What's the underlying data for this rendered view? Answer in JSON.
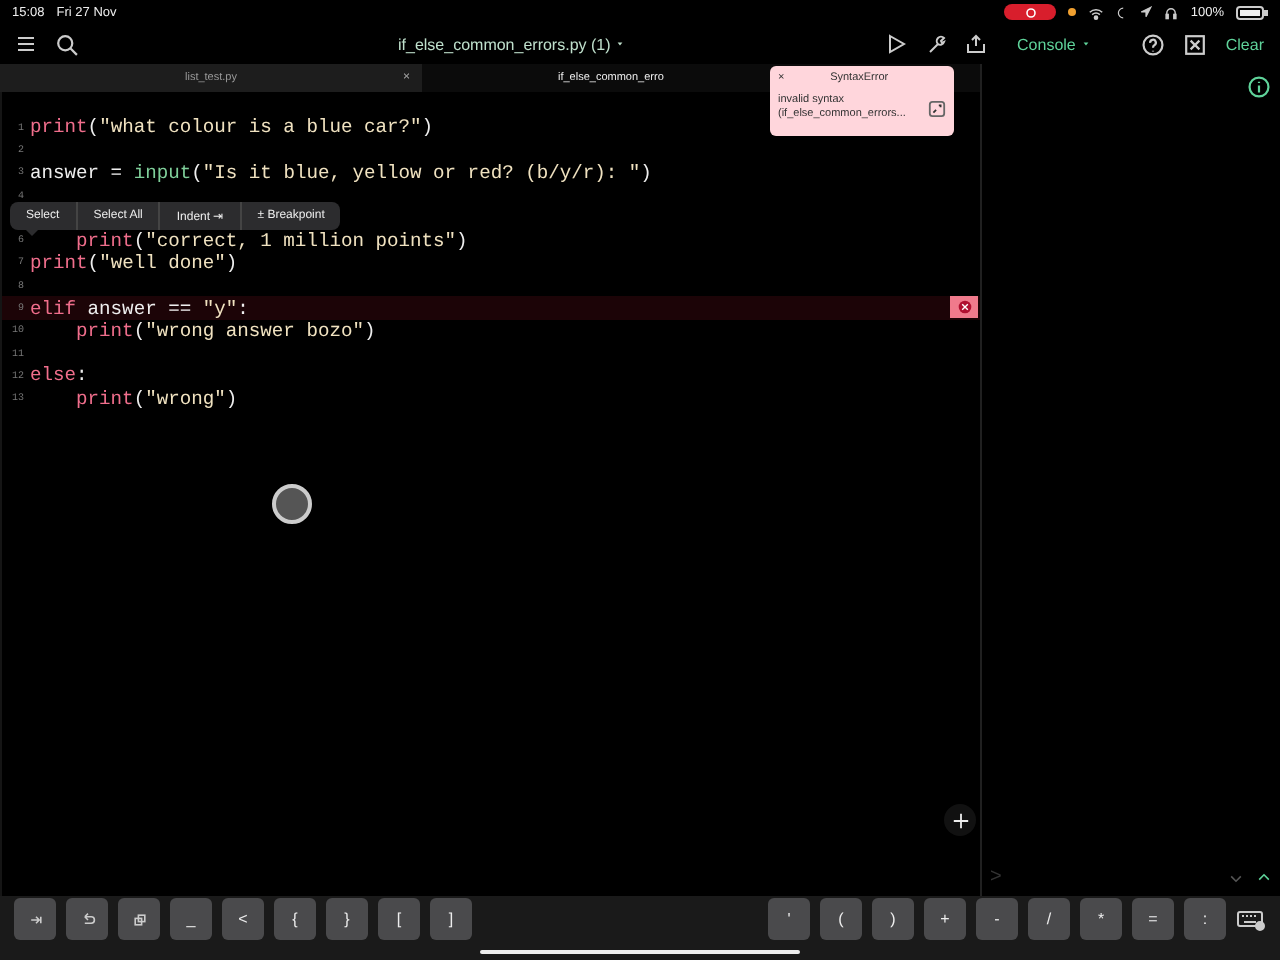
{
  "status_bar": {
    "time": "15:08",
    "date": "Fri 27 Nov",
    "battery": "100%"
  },
  "toolbar": {
    "title": "if_else_common_errors.py (1)",
    "console": "Console",
    "clear": "Clear"
  },
  "tabs": [
    {
      "label": "list_test.py",
      "selected": false,
      "close": "×"
    },
    {
      "label": "if_else_common_erro",
      "selected": true
    }
  ],
  "code_lines": [
    {
      "number": "1",
      "error": false,
      "tokens": [
        {
          "kind": "keyword",
          "t": "print"
        },
        {
          "kind": "plain",
          "t": "("
        },
        {
          "kind": "string",
          "t": "\"what colour is a blue car?\""
        },
        {
          "kind": "plain",
          "t": ")"
        }
      ]
    },
    {
      "number": "2",
      "error": false
    },
    {
      "number": "3",
      "error": false,
      "tokens": [
        {
          "kind": "plain",
          "t": "answer = "
        },
        {
          "kind": "builtin",
          "t": "input"
        },
        {
          "kind": "plain",
          "t": "("
        },
        {
          "kind": "string",
          "t": "\"Is it blue, yellow or red? (b/y/r): \""
        },
        {
          "kind": "plain",
          "t": ")"
        }
      ]
    },
    {
      "number": "4",
      "error": false
    },
    {
      "number": "6",
      "error": false,
      "tokens": [
        {
          "kind": "keyword",
          "t": "    print"
        },
        {
          "kind": "plain",
          "t": "("
        },
        {
          "kind": "string",
          "t": "\"correct, 1 million points\""
        },
        {
          "kind": "plain",
          "t": ")"
        }
      ]
    },
    {
      "number": "7",
      "error": false,
      "tokens": [
        {
          "kind": "keyword",
          "t": "print"
        },
        {
          "kind": "plain",
          "t": "("
        },
        {
          "kind": "string",
          "t": "\"well done\""
        },
        {
          "kind": "plain",
          "t": ")"
        }
      ]
    },
    {
      "number": "8",
      "error": false
    },
    {
      "number": "9",
      "error": true,
      "tokens": [
        {
          "kind": "keyword",
          "t": "elif"
        },
        {
          "kind": "plain",
          "t": " answer == "
        },
        {
          "kind": "string",
          "t": "\"y\""
        },
        {
          "kind": "plain",
          "t": ":"
        }
      ]
    },
    {
      "number": "10",
      "error": false,
      "tokens": [
        {
          "kind": "keyword",
          "t": "    print"
        },
        {
          "kind": "plain",
          "t": "("
        },
        {
          "kind": "string",
          "t": "\"wrong answer bozo\""
        },
        {
          "kind": "plain",
          "t": ")"
        }
      ]
    },
    {
      "number": "11",
      "error": false
    },
    {
      "number": "12",
      "error": false,
      "tokens": [
        {
          "kind": "keyword",
          "t": "else"
        },
        {
          "kind": "plain",
          "t": ":"
        }
      ]
    },
    {
      "number": "13",
      "error": false,
      "tokens": [
        {
          "kind": "keyword",
          "t": "    print"
        },
        {
          "kind": "plain",
          "t": "("
        },
        {
          "kind": "string",
          "t": "\"wrong\""
        },
        {
          "kind": "plain",
          "t": ")"
        }
      ]
    }
  ],
  "context_menu": [
    "Select",
    "Select All",
    "Indent ⇥",
    "± Breakpoint"
  ],
  "error_popup": {
    "close": "×",
    "title": "SyntaxError",
    "message": "invalid syntax",
    "detail": "(if_else_common_errors..."
  },
  "keys_left": [
    {
      "kind": "tab"
    },
    {
      "kind": "undo"
    },
    {
      "kind": "copy"
    },
    {
      "kind": "text",
      "label": "_"
    },
    {
      "kind": "text",
      "label": "<"
    },
    {
      "kind": "text",
      "label": "{"
    },
    {
      "kind": "text",
      "label": "}"
    },
    {
      "kind": "text",
      "label": "["
    },
    {
      "kind": "text",
      "label": "]"
    }
  ],
  "keys_right": [
    {
      "kind": "text",
      "label": "'"
    },
    {
      "kind": "text",
      "label": "("
    },
    {
      "kind": "text",
      "label": ")"
    },
    {
      "kind": "text",
      "label": "+"
    },
    {
      "kind": "text",
      "label": "-"
    },
    {
      "kind": "text",
      "label": "/"
    },
    {
      "kind": "text",
      "label": "*"
    },
    {
      "kind": "text",
      "label": "="
    },
    {
      "kind": "text",
      "label": ":"
    },
    {
      "kind": "keyboard"
    }
  ],
  "console_prompt": ">"
}
